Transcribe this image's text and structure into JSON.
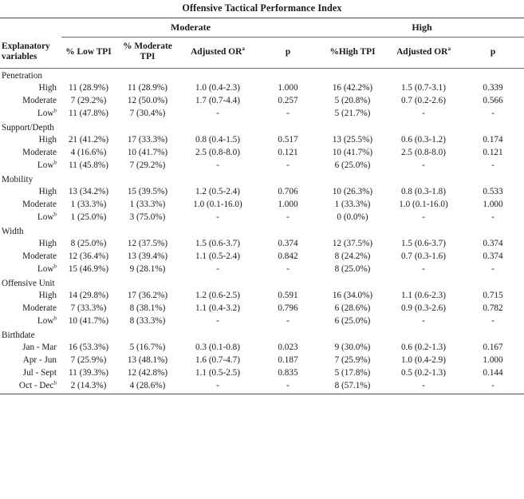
{
  "table": {
    "title": "Offensive Tactical Performance Index",
    "variables_header": "Explanatory variables",
    "groups": [
      {
        "label": "Moderate",
        "span": 4
      },
      {
        "label": "High",
        "span": 3
      }
    ],
    "columns": [
      {
        "key": "low_tpi",
        "label": "% Low TPI"
      },
      {
        "key": "moderate_tpi",
        "label": "% Moderate TPI"
      },
      {
        "key": "mod_or",
        "label": "Adjusted OR",
        "sup": "a"
      },
      {
        "key": "mod_p",
        "label": "p"
      },
      {
        "key": "high_tpi",
        "label": "%High TPI"
      },
      {
        "key": "high_or",
        "label": "Adjusted OR",
        "sup": "a"
      },
      {
        "key": "high_p",
        "label": "p"
      }
    ],
    "sections": [
      {
        "name": "Penetration",
        "rows": [
          {
            "label": "High",
            "sup": "",
            "values": [
              "11 (28.9%)",
              "11 (28.9%)",
              "1.0 (0.4-2.3)",
              "1.000",
              "16 (42.2%)",
              "1.5 (0.7-3.1)",
              "0.339"
            ]
          },
          {
            "label": "Moderate",
            "sup": "",
            "values": [
              "7 (29.2%)",
              "12 (50.0%)",
              "1.7 (0.7-4.4)",
              "0.257",
              "5 (20.8%)",
              "0.7 (0.2-2.6)",
              "0.566"
            ]
          },
          {
            "label": "Low",
            "sup": "b",
            "values": [
              "11 (47.8%)",
              "7 (30.4%)",
              "-",
              "-",
              "5 (21.7%)",
              "-",
              "-"
            ]
          }
        ]
      },
      {
        "name": "Support/Depth",
        "rows": [
          {
            "label": "High",
            "sup": "",
            "values": [
              "21 (41.2%)",
              "17 (33.3%)",
              "0.8 (0.4-1.5)",
              "0.517",
              "13 (25.5%)",
              "0.6 (0.3-1.2)",
              "0.174"
            ]
          },
          {
            "label": "Moderate",
            "sup": "",
            "values": [
              "4 (16.6%)",
              "10 (41.7%)",
              "2.5 (0.8-8.0)",
              "0.121",
              "10 (41.7%)",
              "2.5 (0.8-8.0)",
              "0.121"
            ]
          },
          {
            "label": "Low",
            "sup": "b",
            "values": [
              "11 (45.8%)",
              "7 (29.2%)",
              "-",
              "-",
              "6 (25.0%)",
              "-",
              "-"
            ]
          }
        ]
      },
      {
        "name": "Mobility",
        "rows": [
          {
            "label": "High",
            "sup": "",
            "values": [
              "13 (34.2%)",
              "15 (39.5%)",
              "1.2 (0.5-2.4)",
              "0.706",
              "10 (26.3%)",
              "0.8 (0.3-1.8)",
              "0.533"
            ]
          },
          {
            "label": "Moderate",
            "sup": "",
            "values": [
              "1 (33.3%)",
              "1 (33.3%)",
              "1.0 (0.1-16.0)",
              "1.000",
              "1 (33.3%)",
              "1.0 (0.1-16.0)",
              "1.000"
            ]
          },
          {
            "label": "Low",
            "sup": "b",
            "values": [
              "1 (25.0%)",
              "3 (75.0%)",
              "-",
              "-",
              "0 (0.0%)",
              "-",
              "-"
            ]
          }
        ]
      },
      {
        "name": "Width",
        "rows": [
          {
            "label": "High",
            "sup": "",
            "values": [
              "8 (25.0%)",
              "12 (37.5%)",
              "1.5 (0.6-3.7)",
              "0.374",
              "12 (37.5%)",
              "1.5 (0.6-3.7)",
              "0.374"
            ]
          },
          {
            "label": "Moderate",
            "sup": "",
            "values": [
              "12 (36.4%)",
              "13 (39.4%)",
              "1.1 (0.5-2.4)",
              "0.842",
              "8 (24.2%)",
              "0.7 (0.3-1.6)",
              "0.374"
            ]
          },
          {
            "label": "Low",
            "sup": "b",
            "values": [
              "15 (46.9%)",
              "9 (28.1%)",
              "-",
              "-",
              "8 (25.0%)",
              "-",
              "-"
            ]
          }
        ]
      },
      {
        "name": "Offensive Unit",
        "rows": [
          {
            "label": "High",
            "sup": "",
            "values": [
              "14 (29.8%)",
              "17 (36.2%)",
              "1.2 (0.6-2.5)",
              "0.591",
              "16 (34.0%)",
              "1.1 (0.6-2.3)",
              "0.715"
            ]
          },
          {
            "label": "Moderate",
            "sup": "",
            "values": [
              "7 (33.3%)",
              "8 (38.1%)",
              "1.1 (0.4-3.2)",
              "0.796",
              "6 (28.6%)",
              "0.9 (0.3-2.6)",
              "0.782"
            ]
          },
          {
            "label": "Low",
            "sup": "b",
            "values": [
              "10 (41.7%)",
              "8 (33.3%)",
              "-",
              "-",
              "6 (25.0%)",
              "-",
              "-"
            ]
          }
        ]
      },
      {
        "name": "Birthdate",
        "rows": [
          {
            "label": "Jan - Mar",
            "sup": "",
            "values": [
              "16 (53.3%)",
              "5 (16.7%)",
              "0.3 (0.1-0.8)",
              "0.023",
              "9 (30.0%)",
              "0.6 (0.2-1.3)",
              "0.167"
            ]
          },
          {
            "label": "Apr - Jun",
            "sup": "",
            "values": [
              "7 (25.9%)",
              "13 (48.1%)",
              "1.6 (0.7-4.7)",
              "0.187",
              "7 (25.9%)",
              "1.0 (0.4-2.9)",
              "1.000"
            ]
          },
          {
            "label": "Jul - Sept",
            "sup": "",
            "values": [
              "11 (39.3%)",
              "12 (42.8%)",
              "1.1 (0.5-2.5)",
              "0.835",
              "5 (17.8%)",
              "0.5 (0.2-1.3)",
              "0.144"
            ]
          },
          {
            "label": "Oct - Dec",
            "sup": "b",
            "values": [
              "2 (14.3%)",
              "4 (28.6%)",
              "-",
              "-",
              "8 (57.1%)",
              "-",
              "-"
            ]
          }
        ]
      }
    ]
  }
}
